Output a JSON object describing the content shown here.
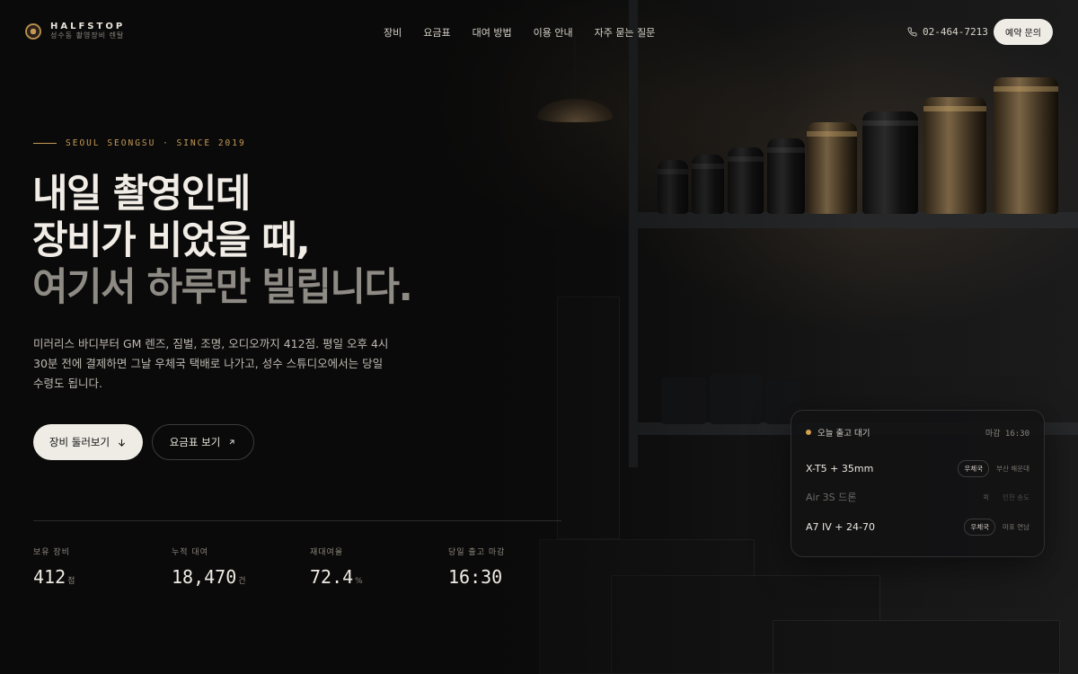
{
  "brand": {
    "name": "HALFSTOP",
    "tagline": "성수동 촬영장비 렌탈",
    "accent": "#c69a55"
  },
  "nav": {
    "items": [
      "장비",
      "요금표",
      "대여 방법",
      "이용 안내",
      "자주 묻는 질문"
    ]
  },
  "header": {
    "phone": "02-464-7213",
    "cta_label": "예약 문의"
  },
  "hero": {
    "eyebrow": "SEOUL SEONGSU · SINCE 2019",
    "title_line1": "내일 촬영인데",
    "title_line2": "장비가 비었을 때,",
    "title_line3": "여기서 하루만 빌립니다.",
    "lead": "미러리스 바디부터 GM 렌즈, 짐벌, 조명, 오디오까지 412점. 평일 오후 4시 30분 전에 결제하면 그날 우체국 택배로 나가고, 성수 스튜디오에서는 당일 수령도 됩니다.",
    "primary_label": "장비 둘러보기",
    "secondary_label": "요금표 보기"
  },
  "stats": [
    {
      "label": "보유 장비",
      "value": "412",
      "unit": "점"
    },
    {
      "label": "누적 대여",
      "value": "18,470",
      "unit": "건"
    },
    {
      "label": "재대여율",
      "value": "72.4",
      "unit": "%"
    },
    {
      "label": "당일 출고 마감",
      "value": "16:30",
      "unit": ""
    }
  ],
  "panel": {
    "title": "오늘 출고 대기",
    "deadline": "마감 16:30",
    "rows": [
      {
        "name": "X-T5 + 35mm",
        "badge": "우체국",
        "location": "부산 해운대",
        "muted": false
      },
      {
        "name": "Air 3S 드론",
        "badge": "퀵",
        "location": "인천 송도",
        "muted": true
      },
      {
        "name": "A7 IV + 24-70",
        "badge": "우체국",
        "location": "마포 연남",
        "muted": false
      }
    ]
  }
}
